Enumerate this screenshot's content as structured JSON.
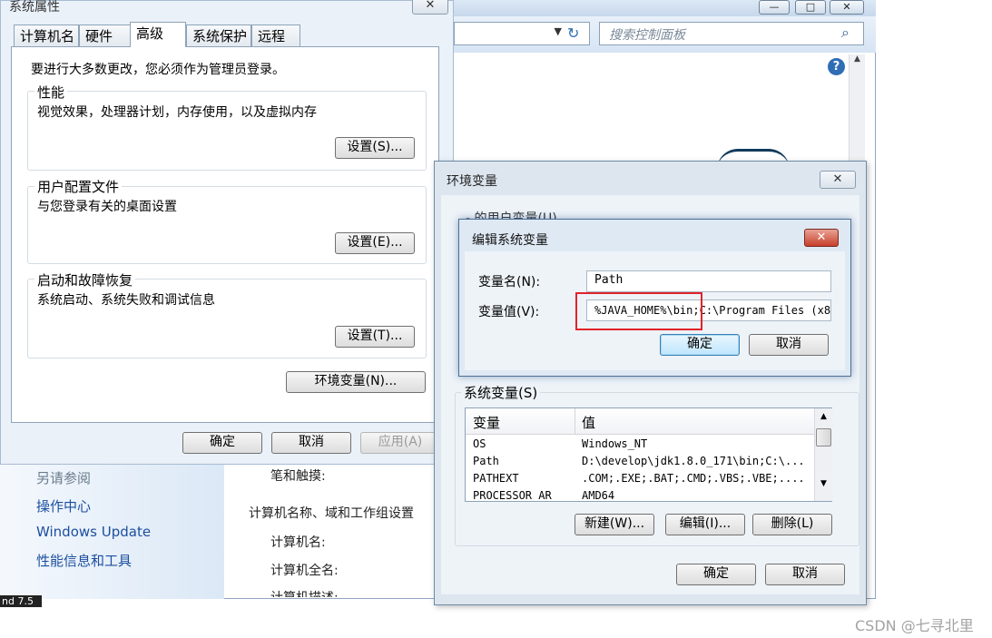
{
  "control_panel": {
    "search_placeholder": "搜索控制面板",
    "see_also": "另请参阅",
    "links": [
      "操作中心",
      "Windows Update",
      "性能信息和工具"
    ],
    "pen_touch": "笔和触摸:",
    "section_title": "计算机名称、域和工作组设置",
    "computer_name": "计算机名:",
    "full_computer_name": "计算机全名:",
    "computer_desc": "计算机描述:",
    "edition_fragment": "nd 7.5"
  },
  "system_properties": {
    "title": "系统属性",
    "close": "✕",
    "tabs": [
      "计算机名",
      "硬件",
      "高级",
      "系统保护",
      "远程"
    ],
    "active_tab": "高级",
    "admin_notice": "要进行大多数更改，您必须作为管理员登录。",
    "performance": {
      "title": "性能",
      "desc": "视觉效果，处理器计划，内存使用，以及虚拟内存",
      "button": "设置(S)..."
    },
    "user_profiles": {
      "title": "用户配置文件",
      "desc": "与您登录有关的桌面设置",
      "button": "设置(E)..."
    },
    "startup_recovery": {
      "title": "启动和故障恢复",
      "desc": "系统启动、系统失败和调试信息",
      "button": "设置(T)..."
    },
    "env_button": "环境变量(N)...",
    "ok": "确定",
    "cancel": "取消",
    "apply": "应用(A)"
  },
  "environment_variables": {
    "title": "环境变量",
    "close": "✕",
    "user_vars_label": "的用户变量(U)",
    "system_vars_label": "系统变量(S)",
    "columns": [
      "变量",
      "值"
    ],
    "rows": [
      {
        "name": "OS",
        "value": "Windows_NT"
      },
      {
        "name": "Path",
        "value": "D:\\develop\\jdk1.8.0_171\\bin;C:\\..."
      },
      {
        "name": "PATHEXT",
        "value": ".COM;.EXE;.BAT;.CMD;.VBS;.VBE;...."
      },
      {
        "name": "PROCESSOR_AR",
        "value": "AMD64"
      }
    ],
    "new": "新建(W)...",
    "edit": "编辑(I)...",
    "delete": "删除(L)",
    "ok": "确定",
    "cancel": "取消"
  },
  "edit_system_variable": {
    "title": "编辑系统变量",
    "close": "✕",
    "name_label": "变量名(N):",
    "name_value": "Path",
    "value_label": "变量值(V):",
    "value_value": "%JAVA_HOME%\\bin;C:\\Program Files (x8",
    "ok": "确定",
    "cancel": "取消"
  },
  "watermark": "CSDN @七寻北里",
  "colors": {
    "highlight": "#e1232a",
    "link": "#1c4fa0",
    "help": "#2f6db5"
  }
}
